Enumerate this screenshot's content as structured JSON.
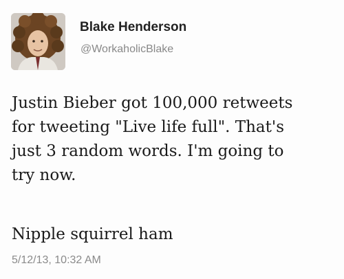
{
  "tweet": {
    "author": {
      "name": "Blake Henderson",
      "handle": "@WorkaholicBlake",
      "avatar_icon": "avatar-photo"
    },
    "text_lines": [
      "Justin Bieber got 100,000 retweets",
      "for tweeting \"Live life full\". That's",
      "just 3 random words. I'm going to",
      "try now."
    ],
    "punchline": "Nipple squirrel ham",
    "timestamp": "5/12/13, 10:32 AM"
  }
}
